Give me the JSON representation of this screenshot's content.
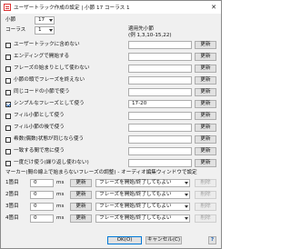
{
  "window": {
    "title": "ユーザートラック作成の設定 | 小節 17 コーラス 1",
    "close_glyph": "✕"
  },
  "bar_label": "小節",
  "bar_value": "17",
  "chorus_label": "コーラス",
  "chorus_value": "1",
  "applied_bars_label": "適用先小節",
  "applied_bars_example": "(例 1,3,10-15,22)",
  "rules": [
    {
      "label": "ユーザートラックに含めない",
      "checked": false,
      "value": "",
      "button": "更新"
    },
    {
      "label": "エンディングで開始する",
      "checked": false,
      "value": "",
      "button": "更新"
    },
    {
      "label": "フレーズの始まりとして使わない",
      "checked": false,
      "value": "",
      "button": "更新"
    },
    {
      "label": "小節の頭でフレーズを終えない",
      "checked": false,
      "value": "",
      "button": "更新"
    },
    {
      "label": "同じコードの小節で使う",
      "checked": false,
      "value": "",
      "button": "更新"
    },
    {
      "label": "シンプルなフレーズとして使う",
      "checked": true,
      "value": "17-20",
      "button": "更新"
    },
    {
      "label": "フィル小節として使う",
      "checked": false,
      "value": "",
      "button": "更新"
    },
    {
      "label": "フィル小節の後で使う",
      "checked": false,
      "value": "",
      "button": "更新"
    },
    {
      "label": "希数(偶数)状態が同じなら使う",
      "checked": false,
      "value": "",
      "button": "更新"
    },
    {
      "label": "一致する間で常に使う",
      "checked": false,
      "value": "",
      "button": "更新"
    },
    {
      "label": "一度だけ使う(繰り返し使わない)",
      "checked": false,
      "value": "",
      "button": "更新"
    }
  ],
  "marker_section_title": "マーカー(間の線上で始まらないフレーズの調整) - オーディオ編集ウィンドウで設定",
  "markers": [
    {
      "label": "1箇目",
      "value": "0",
      "unit": "ms",
      "update": "更新",
      "mode": "フレーズを開始/終了してもよい",
      "delete": "削除"
    },
    {
      "label": "2箇目",
      "value": "0",
      "unit": "ms",
      "update": "更新",
      "mode": "フレーズを開始/終了してもよい",
      "delete": "削除"
    },
    {
      "label": "3箇目",
      "value": "0",
      "unit": "ms",
      "update": "更新",
      "mode": "フレーズを開始/終了してもよい",
      "delete": "削除"
    },
    {
      "label": "4箇目",
      "value": "0",
      "unit": "ms",
      "update": "更新",
      "mode": "フレーズを開始/終了してもよい",
      "delete": "削除"
    }
  ],
  "footer": {
    "ok": "OK(O)",
    "cancel": "キャンセル(C)",
    "help": "?"
  }
}
